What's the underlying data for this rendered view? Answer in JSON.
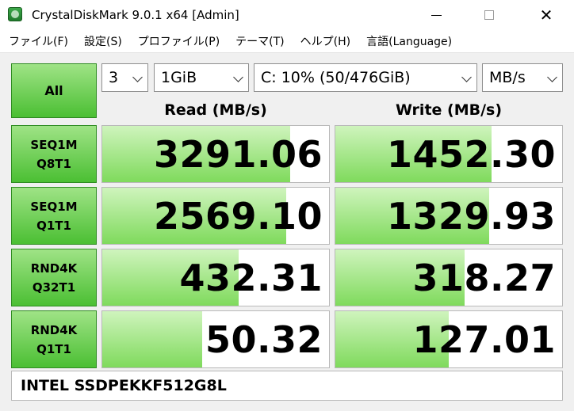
{
  "window": {
    "title": "CrystalDiskMark 9.0.1 x64 [Admin]"
  },
  "menu": [
    "ファイル(F)",
    "設定(S)",
    "プロファイル(P)",
    "テーマ(T)",
    "ヘルプ(H)",
    "言語(Language)"
  ],
  "controls": {
    "all_label": "All",
    "count": "3",
    "size": "1GiB",
    "drive": "C: 10% (50/476GiB)",
    "unit": "MB/s"
  },
  "headers": {
    "read": "Read (MB/s)",
    "write": "Write (MB/s)"
  },
  "tests": [
    {
      "line1": "SEQ1M",
      "line2": "Q8T1",
      "read": "3291.06",
      "write": "1452.30",
      "read_fill": 0.83,
      "write_fill": 0.69
    },
    {
      "line1": "SEQ1M",
      "line2": "Q1T1",
      "read": "2569.10",
      "write": "1329.93",
      "read_fill": 0.81,
      "write_fill": 0.68
    },
    {
      "line1": "RND4K",
      "line2": "Q32T1",
      "read": "432.31",
      "write": "318.27",
      "read_fill": 0.6,
      "write_fill": 0.57
    },
    {
      "line1": "RND4K",
      "line2": "Q1T1",
      "read": "50.32",
      "write": "127.01",
      "read_fill": 0.44,
      "write_fill": 0.5
    }
  ],
  "drive_name": "INTEL SSDPEKKF512G8L",
  "colors": {
    "bar_top": "#cff4bd",
    "bar_bottom": "#7fda5c",
    "button_top": "#9fe386",
    "button_bottom": "#4bbf33"
  }
}
